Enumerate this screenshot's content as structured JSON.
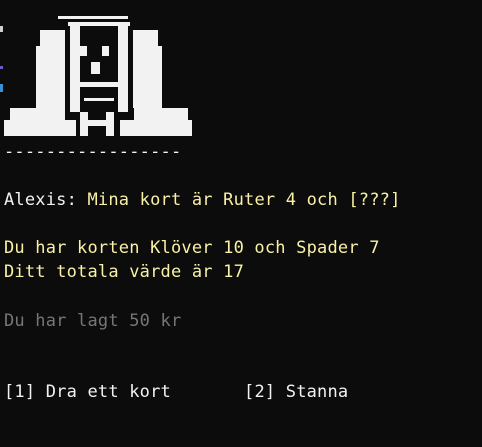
{
  "console": {
    "divider": "-----------------",
    "dealer": {
      "speaker": "Alexis:",
      "speech": "Mina kort är Ruter 4 och [???]"
    },
    "hand_text": "Du har korten Klöver 10 och Spader 7",
    "total_text": "Ditt totala värde är 17",
    "bet_text": "Du har lagt 50 kr",
    "menu": {
      "option1": "[1] Dra ett kort",
      "option2": "[2] Stanna"
    }
  },
  "colors": {
    "background": "#0c0c0c",
    "text_white": "#f2f2f2",
    "text_yellow": "#f9f1a5",
    "text_gray": "#767676"
  },
  "art": {
    "icon": "ascii-dealer-figure"
  }
}
